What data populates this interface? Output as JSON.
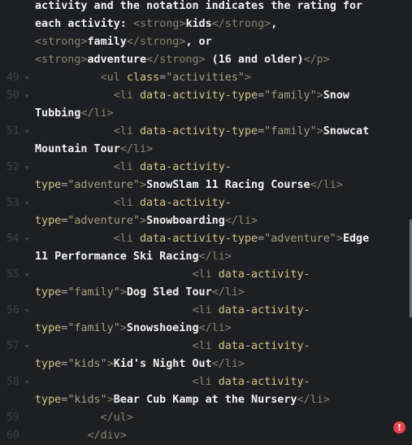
{
  "editor": {
    "colors": {
      "background": "#1e1f22",
      "tag": "#8c8470",
      "attribute": "#d4c68a",
      "string": "#a89f84",
      "text": "#f2f2f2",
      "error": "#e8404c"
    },
    "rows": [
      {
        "num": "",
        "fold": false,
        "tokens": [
          [
            "text",
            "activity and the notation indicates the rating for"
          ]
        ]
      },
      {
        "num": "",
        "fold": false,
        "tokens": [
          [
            "text",
            "each activity: "
          ],
          [
            "tag",
            "<strong>"
          ],
          [
            "text",
            "kids"
          ],
          [
            "tag",
            "</strong>"
          ],
          [
            "text",
            ","
          ]
        ]
      },
      {
        "num": "",
        "fold": false,
        "tokens": [
          [
            "tag",
            "<strong>"
          ],
          [
            "text",
            "family"
          ],
          [
            "tag",
            "</strong>"
          ],
          [
            "text",
            ", or"
          ]
        ]
      },
      {
        "num": "",
        "fold": false,
        "tokens": [
          [
            "tag",
            "<strong>"
          ],
          [
            "text",
            "adventure"
          ],
          [
            "tag",
            "</strong>"
          ],
          [
            "text",
            " (16 and older)"
          ],
          [
            "tag",
            "</p>"
          ]
        ]
      },
      {
        "num": "49",
        "fold": true,
        "tokens": [
          [
            "text",
            "          "
          ],
          [
            "tag",
            "<ul "
          ],
          [
            "attr",
            "class"
          ],
          [
            "eq",
            "="
          ],
          [
            "str",
            "\"activities\""
          ],
          [
            "tag",
            ">"
          ]
        ]
      },
      {
        "num": "50",
        "fold": true,
        "tokens": [
          [
            "text",
            "            "
          ],
          [
            "tag",
            "<li "
          ],
          [
            "attr",
            "data-activity-type"
          ],
          [
            "eq",
            "="
          ],
          [
            "str",
            "\"family\""
          ],
          [
            "tag",
            ">"
          ],
          [
            "text",
            "Snow"
          ]
        ]
      },
      {
        "num": "",
        "fold": false,
        "tokens": [
          [
            "text",
            "Tubbing"
          ],
          [
            "tag",
            "</li>"
          ]
        ]
      },
      {
        "num": "51",
        "fold": true,
        "tokens": [
          [
            "text",
            "            "
          ],
          [
            "tag",
            "<li "
          ],
          [
            "attr",
            "data-activity-type"
          ],
          [
            "eq",
            "="
          ],
          [
            "str",
            "\"family\""
          ],
          [
            "tag",
            ">"
          ],
          [
            "text",
            "Snowcat"
          ]
        ]
      },
      {
        "num": "",
        "fold": false,
        "tokens": [
          [
            "text",
            "Mountain Tour"
          ],
          [
            "tag",
            "</li>"
          ]
        ]
      },
      {
        "num": "52",
        "fold": true,
        "tokens": [
          [
            "text",
            "            "
          ],
          [
            "tag",
            "<li "
          ],
          [
            "attr",
            "data-activity-"
          ]
        ]
      },
      {
        "num": "",
        "fold": false,
        "tokens": [
          [
            "attr",
            "type"
          ],
          [
            "eq",
            "="
          ],
          [
            "str",
            "\"adventure\""
          ],
          [
            "tag",
            ">"
          ],
          [
            "text",
            "SnowSlam 11 Racing Course"
          ],
          [
            "tag",
            "</li>"
          ]
        ]
      },
      {
        "num": "53",
        "fold": true,
        "tokens": [
          [
            "text",
            "            "
          ],
          [
            "tag",
            "<li "
          ],
          [
            "attr",
            "data-activity-"
          ]
        ]
      },
      {
        "num": "",
        "fold": false,
        "tokens": [
          [
            "attr",
            "type"
          ],
          [
            "eq",
            "="
          ],
          [
            "str",
            "\"adventure\""
          ],
          [
            "tag",
            ">"
          ],
          [
            "text",
            "Snowboarding"
          ],
          [
            "tag",
            "</li>"
          ]
        ]
      },
      {
        "num": "54",
        "fold": true,
        "tokens": [
          [
            "text",
            "            "
          ],
          [
            "tag",
            "<li "
          ],
          [
            "attr",
            "data-activity-type"
          ],
          [
            "eq",
            "="
          ],
          [
            "str",
            "\"adventure\""
          ],
          [
            "tag",
            ">"
          ],
          [
            "text",
            "Edge"
          ]
        ]
      },
      {
        "num": "",
        "fold": false,
        "tokens": [
          [
            "text",
            "11 Performance Ski Racing"
          ],
          [
            "tag",
            "</li>"
          ]
        ]
      },
      {
        "num": "55",
        "fold": true,
        "tokens": [
          [
            "text",
            "                        "
          ],
          [
            "tag",
            "<li "
          ],
          [
            "attr",
            "data-activity-"
          ]
        ]
      },
      {
        "num": "",
        "fold": false,
        "tokens": [
          [
            "attr",
            "type"
          ],
          [
            "eq",
            "="
          ],
          [
            "str",
            "\"family\""
          ],
          [
            "tag",
            ">"
          ],
          [
            "text",
            "Dog Sled Tour"
          ],
          [
            "tag",
            "</li>"
          ]
        ]
      },
      {
        "num": "56",
        "fold": true,
        "tokens": [
          [
            "text",
            "                        "
          ],
          [
            "tag",
            "<li "
          ],
          [
            "attr",
            "data-activity-"
          ]
        ]
      },
      {
        "num": "",
        "fold": false,
        "tokens": [
          [
            "attr",
            "type"
          ],
          [
            "eq",
            "="
          ],
          [
            "str",
            "\"family\""
          ],
          [
            "tag",
            ">"
          ],
          [
            "text",
            "Snowshoeing"
          ],
          [
            "tag",
            "</li>"
          ]
        ]
      },
      {
        "num": "57",
        "fold": true,
        "tokens": [
          [
            "text",
            "                        "
          ],
          [
            "tag",
            "<li "
          ],
          [
            "attr",
            "data-activity-"
          ]
        ]
      },
      {
        "num": "",
        "fold": false,
        "tokens": [
          [
            "attr",
            "type"
          ],
          [
            "eq",
            "="
          ],
          [
            "str",
            "\"kids\""
          ],
          [
            "tag",
            ">"
          ],
          [
            "text",
            "Kid's Night Out"
          ],
          [
            "tag",
            "</li>"
          ]
        ]
      },
      {
        "num": "58",
        "fold": true,
        "tokens": [
          [
            "text",
            "                        "
          ],
          [
            "tag",
            "<li "
          ],
          [
            "attr",
            "data-activity-"
          ]
        ]
      },
      {
        "num": "",
        "fold": false,
        "tokens": [
          [
            "attr",
            "type"
          ],
          [
            "eq",
            "="
          ],
          [
            "str",
            "\"kids\""
          ],
          [
            "tag",
            ">"
          ],
          [
            "text",
            "Bear Cub Kamp at the Nursery"
          ],
          [
            "tag",
            "</li>"
          ]
        ]
      },
      {
        "num": "59",
        "fold": false,
        "tokens": [
          [
            "text",
            "          "
          ],
          [
            "tag",
            "</ul>"
          ]
        ]
      },
      {
        "num": "60",
        "fold": false,
        "tokens": [
          [
            "text",
            "        "
          ],
          [
            "tag",
            "</div>"
          ]
        ]
      }
    ],
    "error_icon": "exclamation-circle-icon",
    "error_glyph": "!"
  }
}
